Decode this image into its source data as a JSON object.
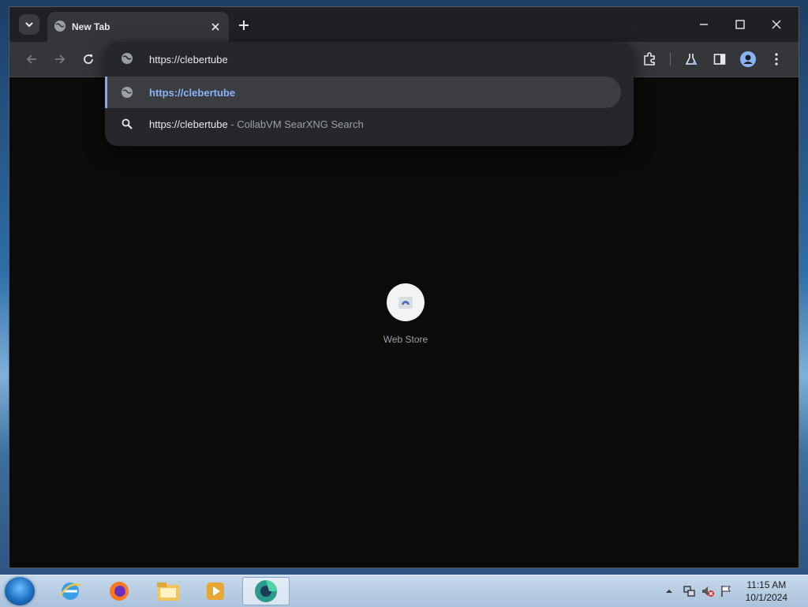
{
  "browser": {
    "tab": {
      "title": "New Tab"
    },
    "omnibox": {
      "input_value": "https://clebertube",
      "suggestions": [
        {
          "text": "https://clebertube",
          "sub": "",
          "icon": "globe-icon"
        },
        {
          "text": "https://clebertube",
          "sub": " - CollabVM SearXNG Search",
          "icon": "search-icon"
        }
      ]
    }
  },
  "ntp": {
    "shortcuts": [
      {
        "label": "Web Store"
      }
    ]
  },
  "taskbar": {
    "apps": [
      "internet-explorer-icon",
      "firefox-icon",
      "file-explorer-icon",
      "media-player-icon",
      "browser-icon"
    ],
    "clock": {
      "time": "11:15 AM",
      "date": "10/1/2024"
    }
  },
  "colors": {
    "accent": "#8ab4f8",
    "toolbar": "#35363a",
    "background": "#000000"
  }
}
